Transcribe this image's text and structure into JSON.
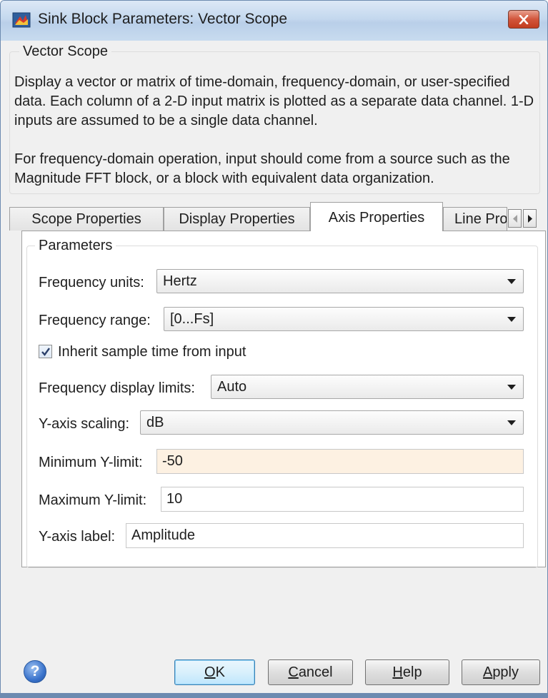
{
  "window": {
    "title": "Sink Block Parameters: Vector Scope"
  },
  "description": {
    "legend": "Vector Scope",
    "paragraph1": "Display a vector or matrix of time-domain, frequency-domain, or user-specified data.  Each column of a 2-D input matrix is plotted as a separate data channel.  1-D inputs are assumed to be a single data channel.",
    "paragraph2": "For frequency-domain operation, input should come from a source such as the Magnitude FFT block, or a block with equivalent data organization."
  },
  "tabs": [
    {
      "label": "Scope Properties",
      "active": false
    },
    {
      "label": "Display Properties",
      "active": false
    },
    {
      "label": "Axis Properties",
      "active": true
    },
    {
      "label": "Line Pro",
      "active": false
    }
  ],
  "parameters": {
    "legend": "Parameters",
    "frequency_units": {
      "label": "Frequency units:",
      "value": "Hertz"
    },
    "frequency_range": {
      "label": "Frequency range:",
      "value": "[0...Fs]"
    },
    "inherit_sample_time": {
      "label": "Inherit sample time from input",
      "checked": true
    },
    "frequency_display_limits": {
      "label": "Frequency display limits:",
      "value": "Auto"
    },
    "y_axis_scaling": {
      "label": "Y-axis scaling:",
      "value": "dB"
    },
    "minimum_y_limit": {
      "label": "Minimum Y-limit:",
      "value": "-50"
    },
    "maximum_y_limit": {
      "label": "Maximum Y-limit:",
      "value": "10"
    },
    "y_axis_label": {
      "label": "Y-axis label:",
      "value": "Amplitude"
    }
  },
  "buttons": {
    "ok": {
      "mnemonic": "O",
      "rest": "K"
    },
    "cancel": {
      "mnemonic": "C",
      "rest": "ancel"
    },
    "help": {
      "mnemonic": "H",
      "rest": "elp"
    },
    "apply": {
      "mnemonic": "A",
      "rest": "pply"
    },
    "help_icon": "?"
  },
  "icons": {
    "app": "simulink-block-icon",
    "close": "close-icon",
    "help": "help-icon",
    "dropdown": "chevron-down-icon",
    "check": "checkmark-icon"
  },
  "colors": {
    "title_bar": "#c4d8ee",
    "close_button": "#d2553b",
    "highlight_field": "#fdf1e2",
    "default_button_border": "#3c7fb1"
  }
}
